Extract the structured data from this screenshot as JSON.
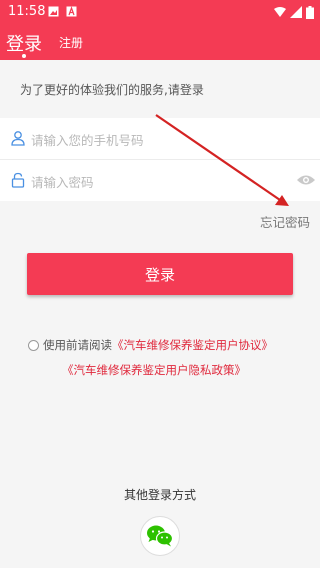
{
  "status_bar": {
    "time": "11:58"
  },
  "tabs": {
    "login": "登录",
    "register": "注册"
  },
  "intro_text": "为了更好的体验我们的服务,请登录",
  "phone_field": {
    "placeholder": "请输入您的手机号码",
    "icon": "user-icon"
  },
  "password_field": {
    "placeholder": "请输入密码",
    "icon": "lock-icon",
    "toggle_icon": "eye-icon"
  },
  "forgot_password": "忘记密码",
  "login_button": "登录",
  "agreement": {
    "prefix": "使用前请阅读",
    "user_agreement": "《汽车维修保养鉴定用户协议》",
    "privacy_policy": "《汽车维修保养鉴定用户隐私政策》"
  },
  "other_login": {
    "label": "其他登录方式",
    "icon": "wechat-icon"
  },
  "colors": {
    "accent": "#f43b54",
    "link": "#e0283c",
    "annotation_arrow": "#d42323"
  }
}
